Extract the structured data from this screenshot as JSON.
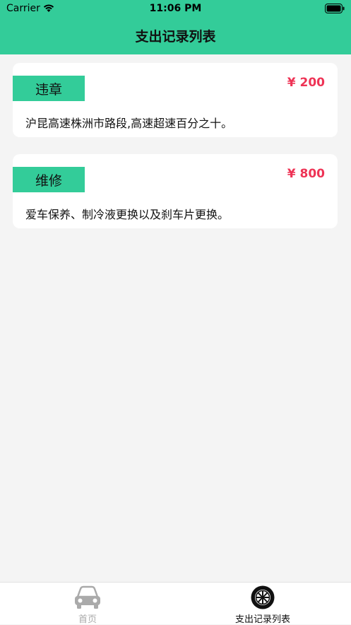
{
  "status": {
    "carrier": "Carrier",
    "time": "11:06 PM"
  },
  "nav": {
    "title": "支出记录列表"
  },
  "records": [
    {
      "tag": "违章",
      "amount": "¥ 200",
      "description": "沪昆高速株洲市路段,高速超速百分之十。"
    },
    {
      "tag": "维修",
      "amount": "¥ 800",
      "description": "爱车保养、制冷液更换以及刹车片更换。"
    }
  ],
  "tabbar": {
    "items": [
      {
        "label": "首页",
        "icon": "car-icon",
        "active": false
      },
      {
        "label": "支出记录列表",
        "icon": "tire-icon",
        "active": true
      }
    ]
  },
  "colors": {
    "accent": "#33cc99",
    "amount": "#ee3355",
    "inactive": "#aaaaaa"
  }
}
